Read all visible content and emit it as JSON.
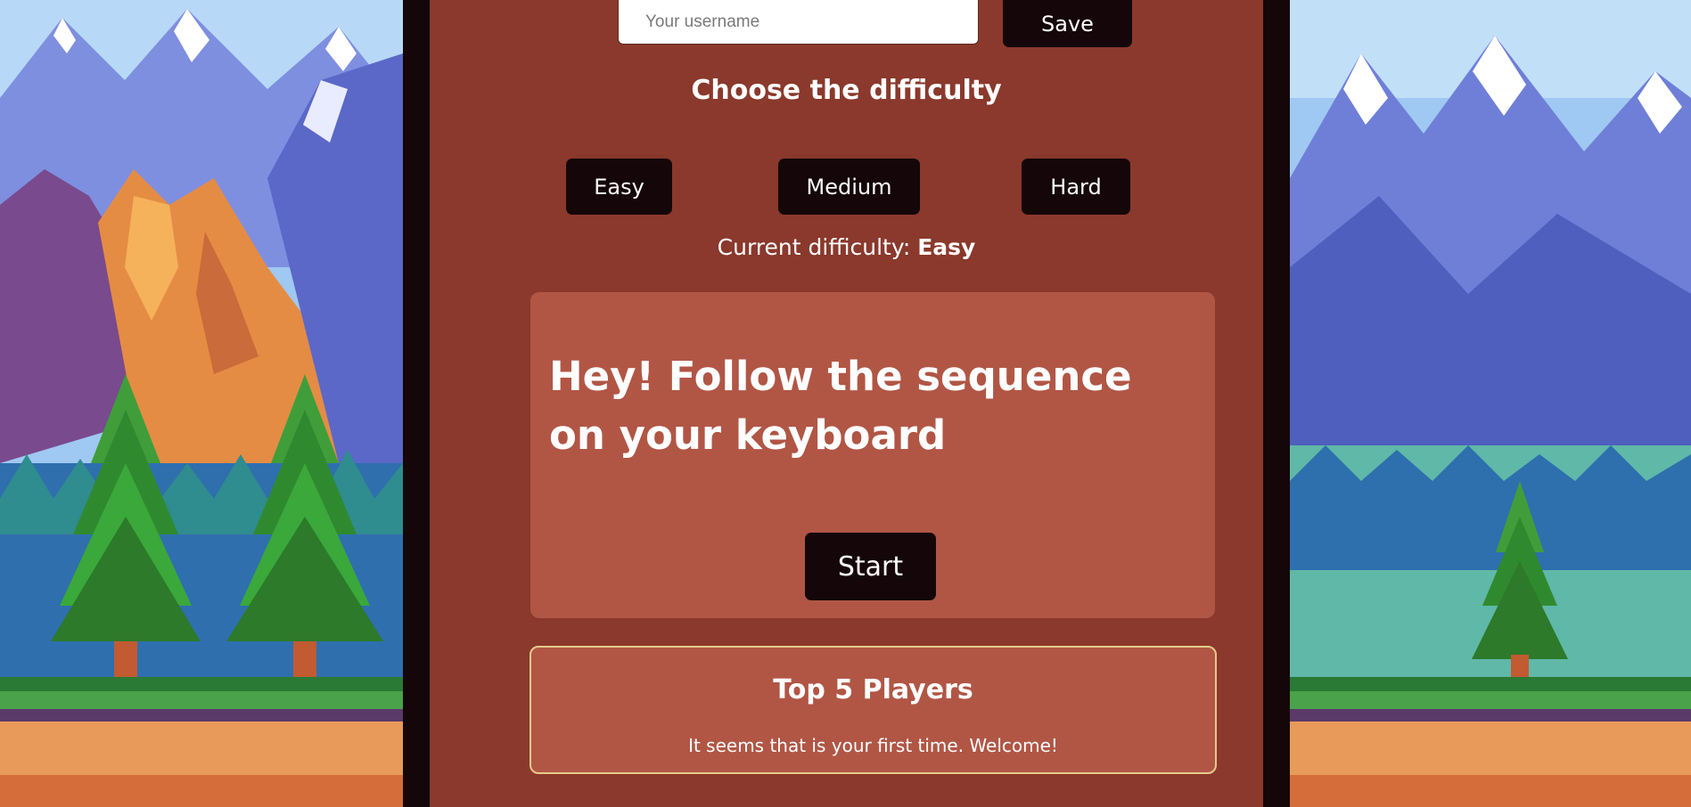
{
  "username": {
    "placeholder": "Your username",
    "value": ""
  },
  "save_label": "Save",
  "difficulty": {
    "title": "Choose the difficulty",
    "options": [
      "Easy",
      "Medium",
      "Hard"
    ],
    "current_label": "Current difficulty:",
    "current_value": "Easy"
  },
  "game": {
    "message": "Hey! Follow the sequence on your keyboard",
    "start_label": "Start"
  },
  "leaderboard": {
    "title": "Top 5 Players",
    "empty_message": "It seems that is your first time. Welcome!"
  },
  "colors": {
    "frame": "#150709",
    "panel": "#8a392c",
    "card": "#b15645",
    "button": "#150709",
    "leaderboard_border": "#e8c98a"
  },
  "background": {
    "left": "pixel-art-mountain-scene-with-two-pine-trees",
    "right": "pixel-art-mountain-scene-with-one-pine-tree"
  }
}
